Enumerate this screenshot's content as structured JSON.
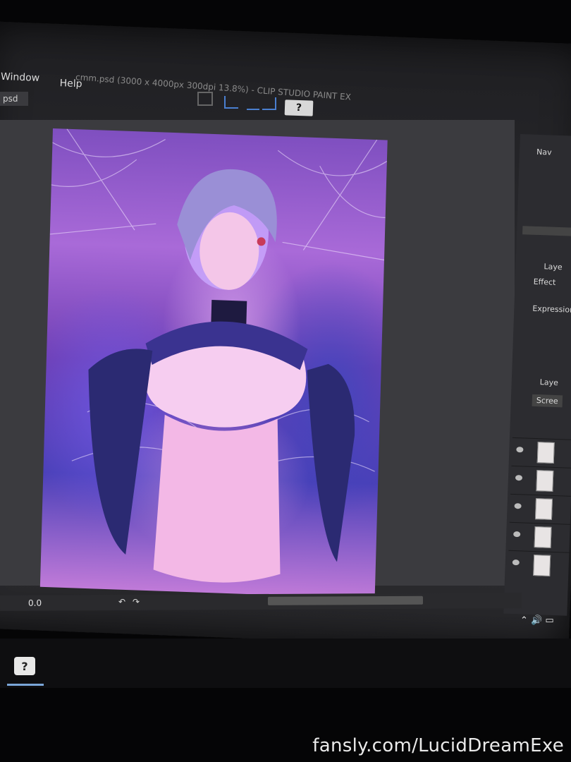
{
  "menubar": {
    "window_label": "Window",
    "help_label": "Help"
  },
  "title_bar": {
    "text": "cmm.psd (3000 x 4000px 300dpi 13.8%) - CLIP STUDIO PAINT EX"
  },
  "doc_tab": {
    "label": "psd"
  },
  "toolbar": {
    "help_icon": "question-icon"
  },
  "side_panel": {
    "navigator_label": "Nav",
    "layer_property_label": "Laye",
    "effect_label": "Effect",
    "expression_label": "Expression",
    "layer_panel_label": "Laye",
    "blend_mode": "Scree"
  },
  "statusbar": {
    "zoom": "0.0"
  },
  "taskbar": {
    "app_icon": "clip-studio-icon"
  },
  "tray": {
    "icons": [
      "chevron-up-icon",
      "volume-icon",
      "network-icon",
      "language-icon"
    ]
  },
  "watermark": {
    "text": "fansly.com/LucidDreamExe"
  },
  "colors": {
    "accent": "#7aa6d8",
    "art_primary": "#a96ad8",
    "art_secondary": "#4a40b8"
  }
}
